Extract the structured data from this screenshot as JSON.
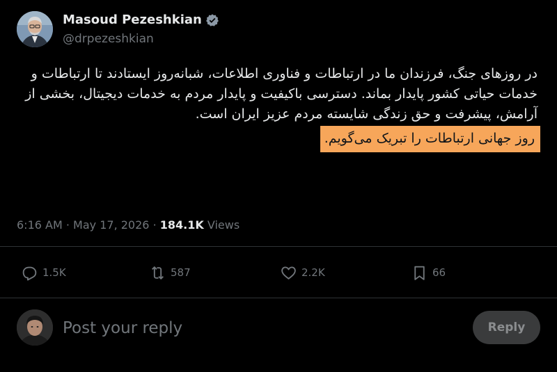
{
  "author": {
    "display_name": "Masoud Pezeshkian",
    "handle": "@drpezeshkian",
    "verified_icon": "verified-badge-icon",
    "verified_color": "#8b98a5"
  },
  "tweet": {
    "text": "در روزهای جنگ، فرزندان ما در ارتباطات و فناوری اطلاعات، شبانه‌روز ایستادند تا ارتباطات و خدمات حیاتی کشور پایدار بماند. دسترسی باکیفیت و پایدار مردم به خدمات دیجیتال، بخشی از آرامش، پیشرفت و حق زندگی شایسته مردم عزیز ایران است.",
    "highlighted_text": "روز جهانی ارتباطات را تبریک می‌گویم.",
    "highlight_color": "#f7a65a"
  },
  "meta": {
    "time": "6:16 AM",
    "separator": "·",
    "date": "May 17, 2026",
    "views_count": "184.1K",
    "views_label": "Views"
  },
  "actions": {
    "reply": {
      "icon": "reply-icon",
      "count": "1.5K"
    },
    "retweet": {
      "icon": "retweet-icon",
      "count": "587"
    },
    "like": {
      "icon": "heart-icon",
      "count": "2.2K"
    },
    "bookmark": {
      "icon": "bookmark-icon",
      "count": "66"
    }
  },
  "compose": {
    "placeholder": "Post your reply",
    "button_label": "Reply"
  },
  "colors": {
    "background": "#000000",
    "text_primary": "#e7e9ea",
    "text_secondary": "#71767b",
    "divider": "#2f3336"
  }
}
